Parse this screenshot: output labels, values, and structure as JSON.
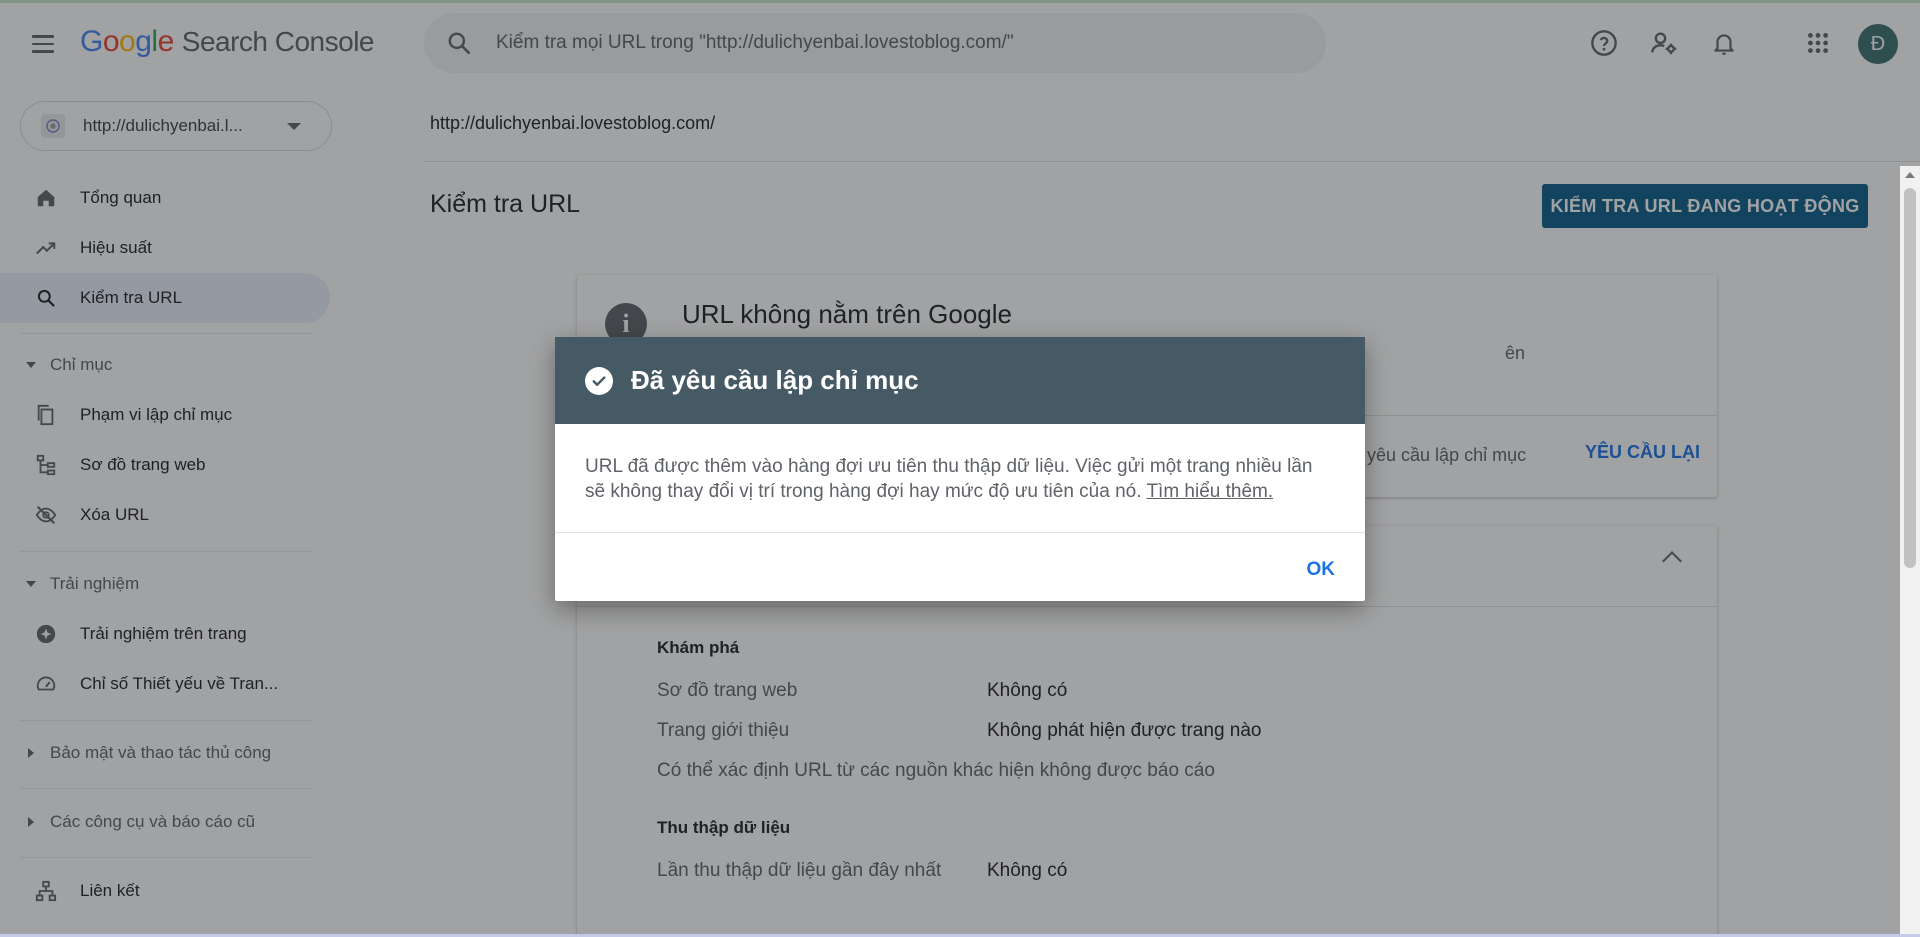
{
  "header": {
    "logo_letters": [
      "G",
      "o",
      "o",
      "g",
      "l",
      "e"
    ],
    "product": "Search Console",
    "search_placeholder": "Kiểm tra mọi URL trong \"http://dulichyenbai.lovestoblog.com/\"",
    "avatar_letter": "Đ"
  },
  "sidebar": {
    "property": "http://dulichyenbai.l...",
    "items": [
      {
        "label": "Tổng quan"
      },
      {
        "label": "Hiệu suất"
      },
      {
        "label": "Kiểm tra URL"
      }
    ],
    "sections": [
      {
        "label": "Chỉ mục"
      },
      {
        "label": "Trải nghiệm"
      },
      {
        "label": "Bảo mật và thao tác thủ công"
      },
      {
        "label": "Các công cụ và báo cáo cũ"
      }
    ],
    "index_items": [
      {
        "label": "Phạm vi lập chỉ mục"
      },
      {
        "label": "Sơ đồ trang web"
      },
      {
        "label": "Xóa URL"
      }
    ],
    "experience_items": [
      {
        "label": "Trải nghiệm trên trang"
      },
      {
        "label": "Chỉ số Thiết yếu về Tran..."
      }
    ],
    "links_item": {
      "label": "Liên kết"
    }
  },
  "main": {
    "url": "http://dulichyenbai.lovestoblog.com/",
    "page_title": "Kiểm tra URL",
    "live_test_button": "KIỂM TRA URL ĐANG HOẠT ĐỘNG",
    "status_card": {
      "title": "URL không nằm trên Google",
      "subtitle_visible": "ên",
      "requested_visible": "ã yêu cầu lập chỉ mục",
      "retry_button": "YÊU CẦU LẠI"
    },
    "coverage_card": {
      "discovery_title": "Khám phá",
      "sitemap_key": "Sơ đồ trang web",
      "sitemap_value": "Không có",
      "referring_key": "Trang giới thiệu",
      "referring_value": "Không phát hiện được trang nào",
      "note": "Có thể xác định URL từ các nguồn khác hiện không được báo cáo",
      "crawl_title": "Thu thập dữ liệu",
      "last_crawl_key": "Lần thu thập dữ liệu gần đây nhất",
      "last_crawl_value": "Không có"
    }
  },
  "dialog": {
    "title": "Đã yêu cầu lập chỉ mục",
    "body": "URL đã được thêm vào hàng đợi ưu tiên thu thập dữ liệu. Việc gửi một trang nhiều lần sẽ không thay đổi vị trí trong hàng đợi hay mức độ ưu tiên của nó.",
    "learn_more": "Tìm hiểu thêm.",
    "ok_button": "OK"
  },
  "colors": {
    "accent": "#1a73e8",
    "dialog_header": "#455a64",
    "live_button": "#0b5e8a",
    "active_nav": "#e8f0fe"
  },
  "icons": [
    "menu-icon",
    "search-icon",
    "help-icon",
    "manage-users-icon",
    "notifications-icon",
    "apps-icon",
    "globe-icon",
    "home-icon",
    "trending-up-icon",
    "search-icon",
    "pages-icon",
    "sitemap-icon",
    "remove-url-icon",
    "experience-icon",
    "speed-icon",
    "links-icon",
    "info-icon",
    "check-circle-icon",
    "chevron-up-icon"
  ]
}
